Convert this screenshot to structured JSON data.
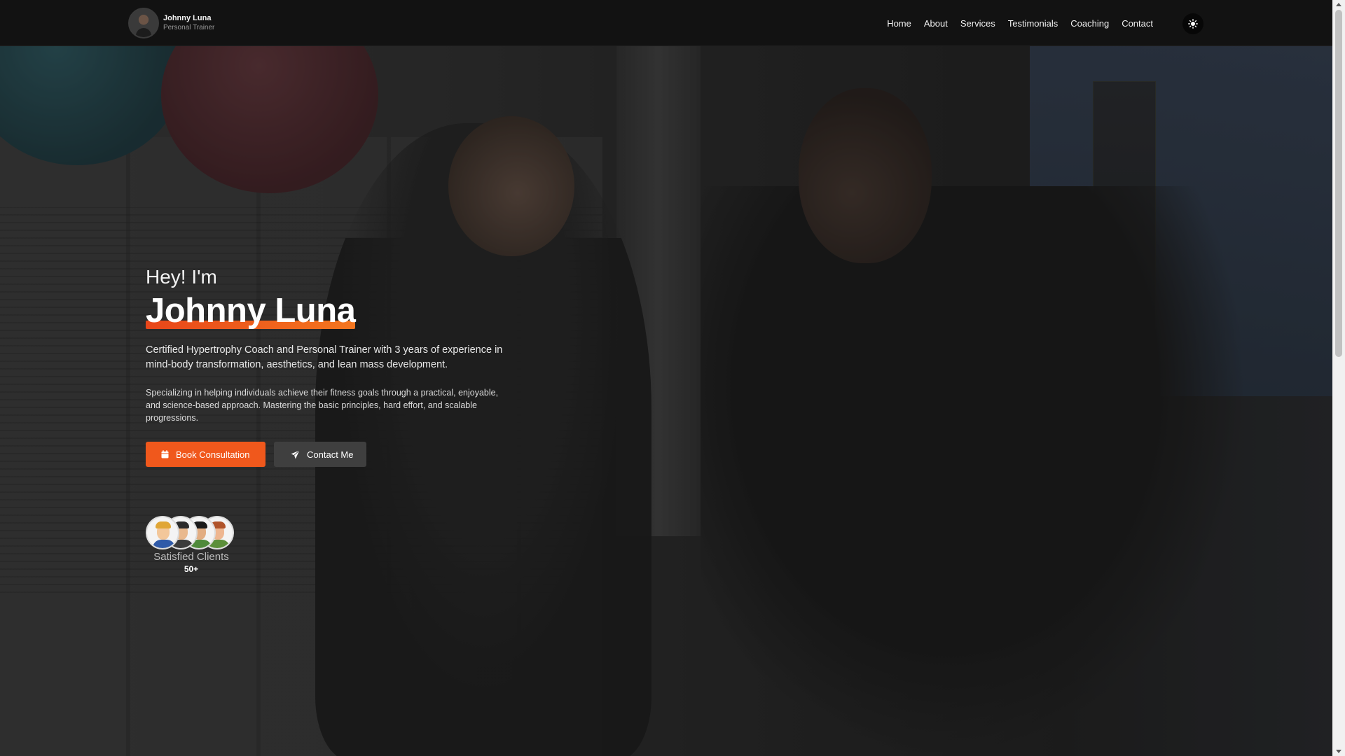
{
  "brand": {
    "name": "Johnny Luna",
    "role": "Personal Trainer"
  },
  "nav": {
    "items": [
      {
        "label": "Home"
      },
      {
        "label": "About"
      },
      {
        "label": "Services"
      },
      {
        "label": "Testimonials"
      },
      {
        "label": "Coaching"
      },
      {
        "label": "Contact"
      }
    ],
    "theme_toggle_icon": "sun-icon"
  },
  "hero": {
    "greeting": "Hey! I'm",
    "name": "Johnny Luna",
    "intro": "Certified Hypertrophy Coach and Personal Trainer with 3 years of experience in mind-body transformation, aesthetics, and lean mass development.",
    "description": "Specializing in helping individuals achieve their fitness goals through a practical, enjoyable, and science-based approach. Mastering the basic principles, hard effort, and scalable progressions.",
    "buttons": {
      "primary": {
        "label": "Book Consultation",
        "icon": "calendar-icon"
      },
      "secondary": {
        "label": "Contact Me",
        "icon": "send-icon"
      }
    }
  },
  "clients": {
    "label": "Satisfied Clients",
    "count": "50+"
  },
  "colors": {
    "accent": "#f0581c",
    "navbar_bg": "#121212",
    "secondary_button": "#3f3f3f"
  }
}
